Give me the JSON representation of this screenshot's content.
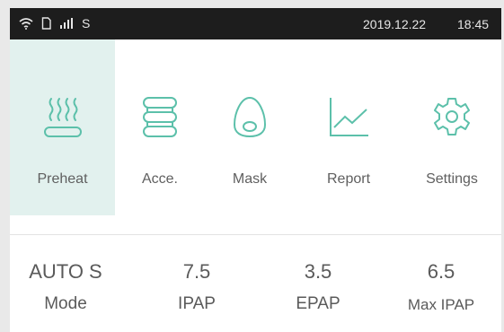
{
  "status_bar": {
    "signal_letter": "S",
    "date": "2019.12.22",
    "time": "18:45"
  },
  "menu": {
    "items": [
      {
        "label": "Preheat",
        "icon": "heating-icon",
        "selected": true
      },
      {
        "label": "Acce.",
        "icon": "accessory-icon",
        "selected": false
      },
      {
        "label": "Mask",
        "icon": "mask-icon",
        "selected": false
      },
      {
        "label": "Report",
        "icon": "report-chart-icon",
        "selected": false
      },
      {
        "label": "Settings",
        "icon": "gear-icon",
        "selected": false
      }
    ]
  },
  "params": [
    {
      "value": "AUTO S",
      "label": "Mode"
    },
    {
      "value": "7.5",
      "label": "IPAP"
    },
    {
      "value": "3.5",
      "label": "EPAP"
    },
    {
      "value": "6.5",
      "label": "Max IPAP"
    }
  ],
  "colors": {
    "accent": "#5cc0aa",
    "selected_bg": "#e2f1ee",
    "status_bar_bg": "#1d1d1d",
    "text": "#5f5f5f"
  }
}
